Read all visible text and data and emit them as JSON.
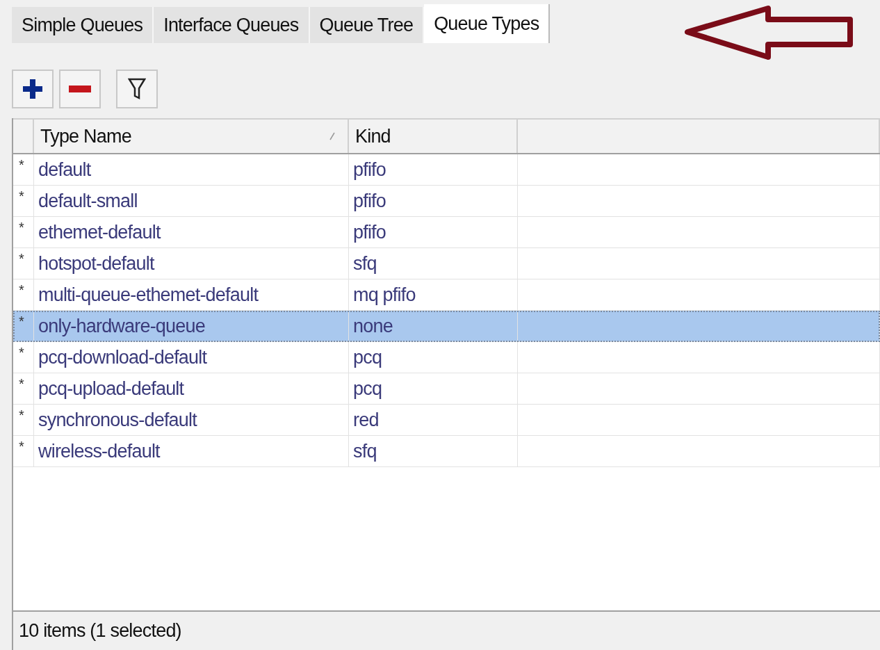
{
  "tabs": [
    {
      "label": "Simple Queues",
      "selected": false
    },
    {
      "label": "Interface Queues",
      "selected": false
    },
    {
      "label": "Queue Tree",
      "selected": false
    },
    {
      "label": "Queue Types",
      "selected": true
    }
  ],
  "toolbar": [
    {
      "kind": "add"
    },
    {
      "kind": "remove"
    },
    {
      "kind": "filter"
    }
  ],
  "table": {
    "columns": [
      "Type Name",
      "Kind"
    ],
    "rows": [
      {
        "flag": "*",
        "name": "default",
        "kind": "pfifo",
        "selected": false
      },
      {
        "flag": "*",
        "name": "default-small",
        "kind": "pfifo",
        "selected": false
      },
      {
        "flag": "*",
        "name": "ethemet-default",
        "kind": "pfifo",
        "selected": false
      },
      {
        "flag": "*",
        "name": "hotspot-default",
        "kind": "sfq",
        "selected": false
      },
      {
        "flag": "*",
        "name": "multi-queue-ethemet-default",
        "kind": "mq pfifo",
        "selected": false
      },
      {
        "flag": "*",
        "name": "only-hardware-queue",
        "kind": "none",
        "selected": true
      },
      {
        "flag": "*",
        "name": "pcq-download-default",
        "kind": "pcq",
        "selected": false
      },
      {
        "flag": "*",
        "name": "pcq-upload-default",
        "kind": "pcq",
        "selected": false
      },
      {
        "flag": "*",
        "name": "synchronous-default",
        "kind": "red",
        "selected": false
      },
      {
        "flag": "*",
        "name": "wireless-default",
        "kind": "sfq",
        "selected": false
      }
    ]
  },
  "status_bar": "10 items (1 selected)"
}
